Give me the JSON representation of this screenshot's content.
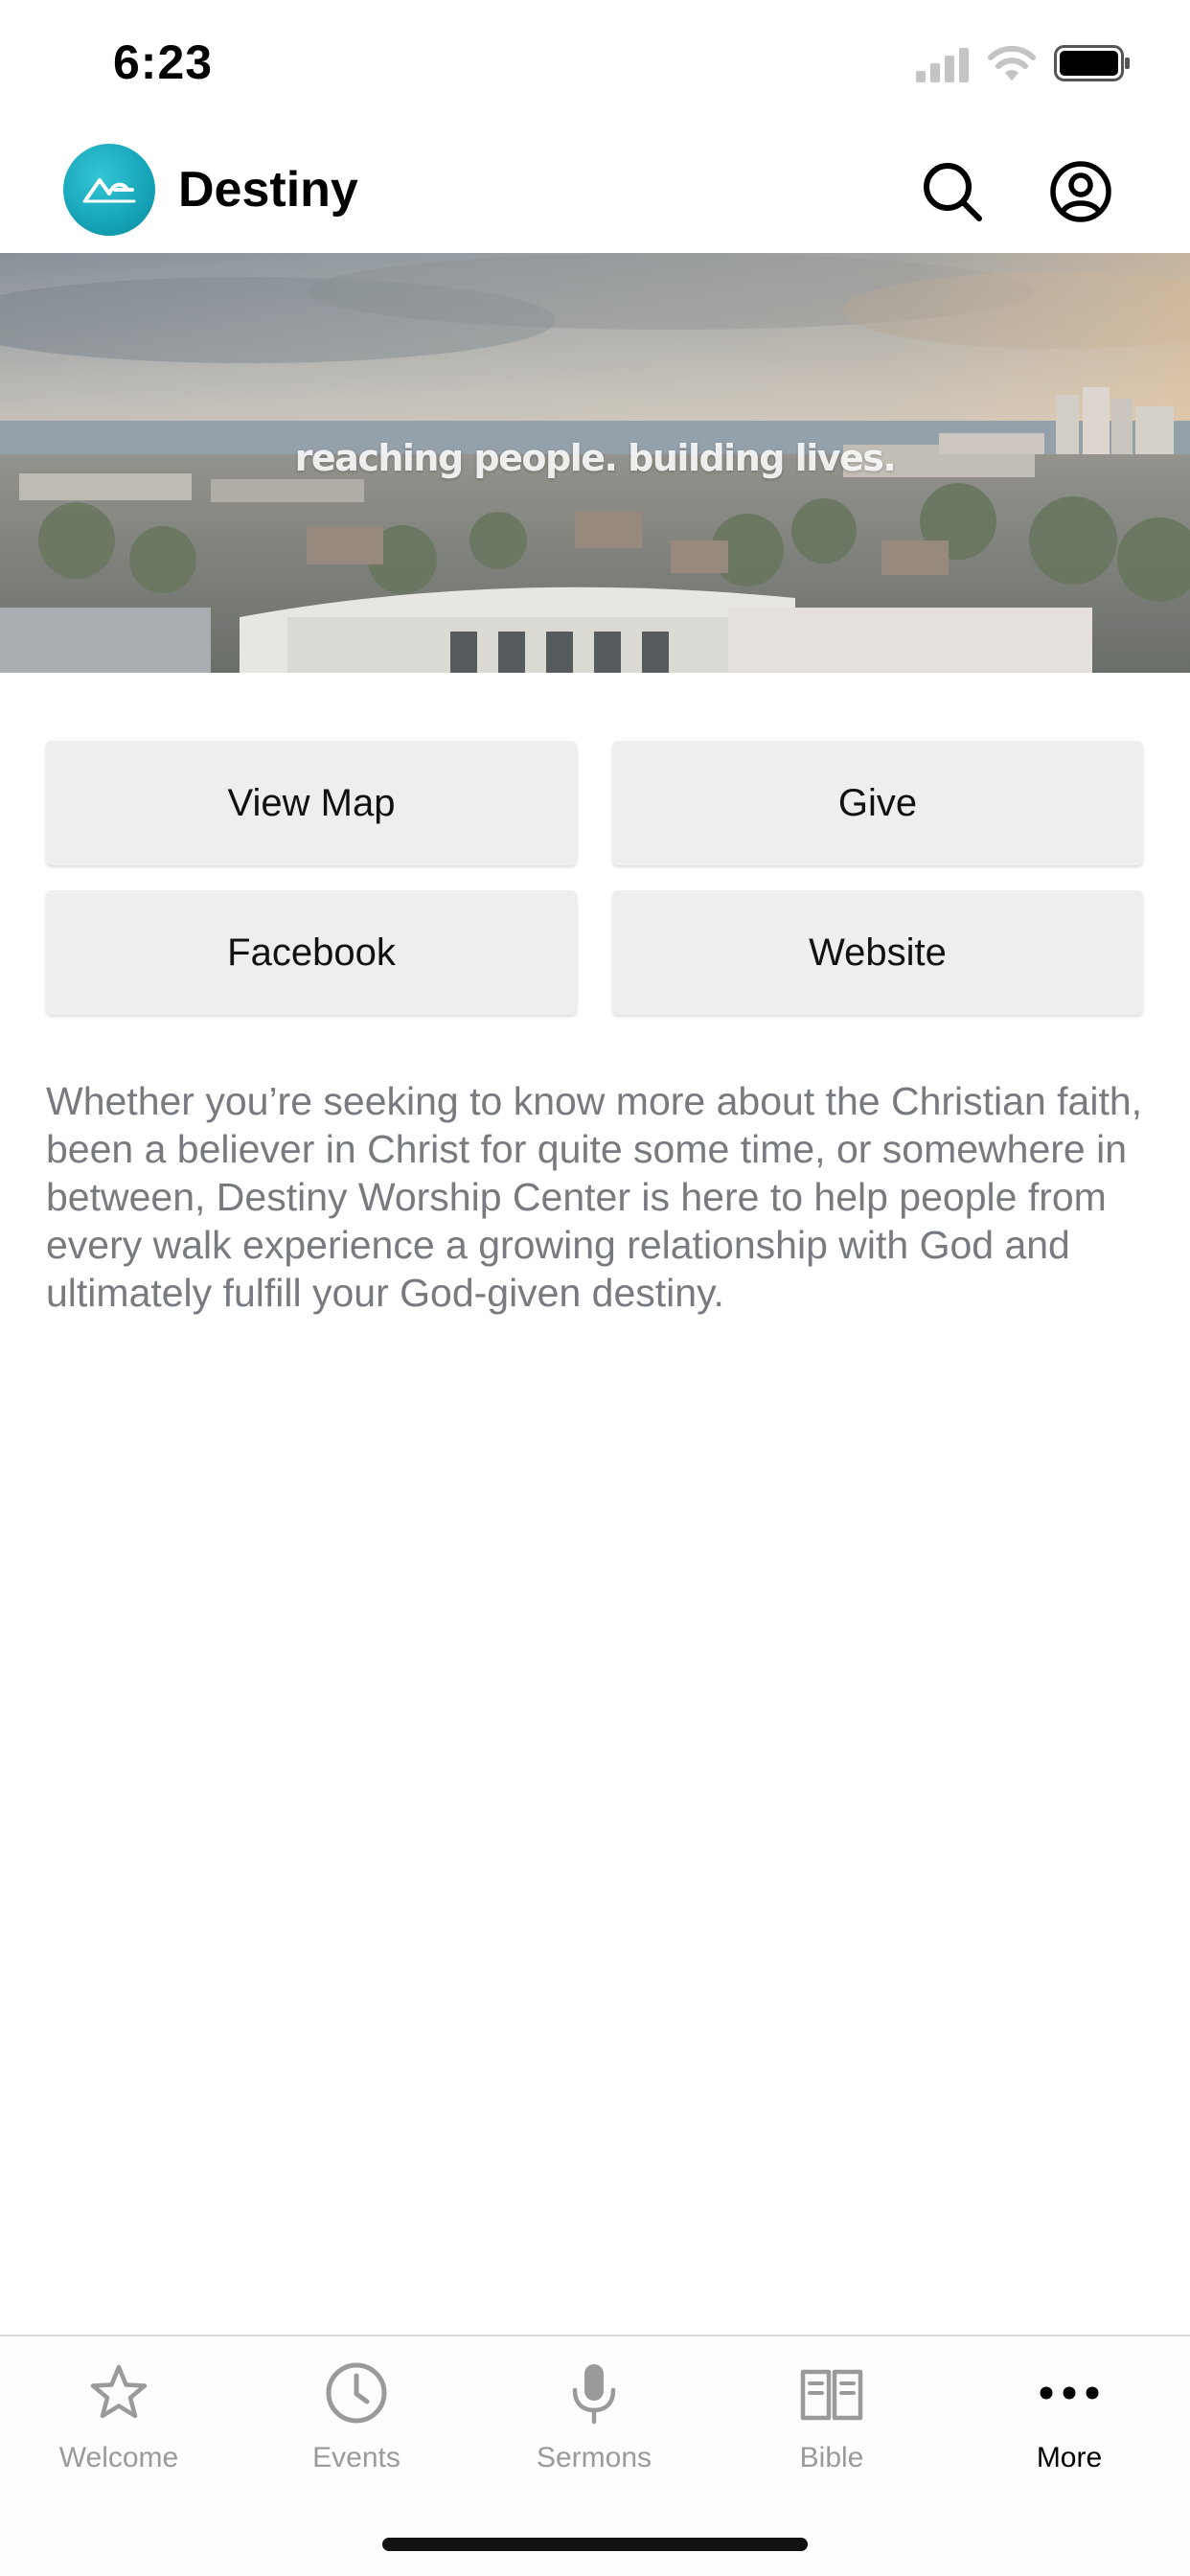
{
  "status_bar": {
    "time": "6:23"
  },
  "header": {
    "title": "Destiny",
    "icons": {
      "logo": "destiny-logo",
      "search": "search-icon",
      "account": "account-icon"
    }
  },
  "banner": {
    "tagline": "reaching people. building lives."
  },
  "actions": {
    "view_map": "View Map",
    "give": "Give",
    "facebook": "Facebook",
    "website": "Website"
  },
  "description": "Whether you’re seeking to know more about the Christian faith, been a believer in Christ for quite some time, or somewhere in between, Destiny Worship Center is here to help people from every walk experience a growing relationship with God and ultimately fulfill your God-given destiny.",
  "tabs": [
    {
      "label": "Welcome",
      "icon": "star-icon",
      "active": false
    },
    {
      "label": "Events",
      "icon": "clock-icon",
      "active": false
    },
    {
      "label": "Sermons",
      "icon": "microphone-icon",
      "active": false
    },
    {
      "label": "Bible",
      "icon": "book-icon",
      "active": false
    },
    {
      "label": "More",
      "icon": "more-dots-icon",
      "active": true
    }
  ],
  "colors": {
    "logo_accent": "#17a7b9",
    "button_bg": "#eceef0",
    "description_text": "#777a7f",
    "tab_inactive": "#9a9a9a",
    "tab_active": "#000000"
  }
}
